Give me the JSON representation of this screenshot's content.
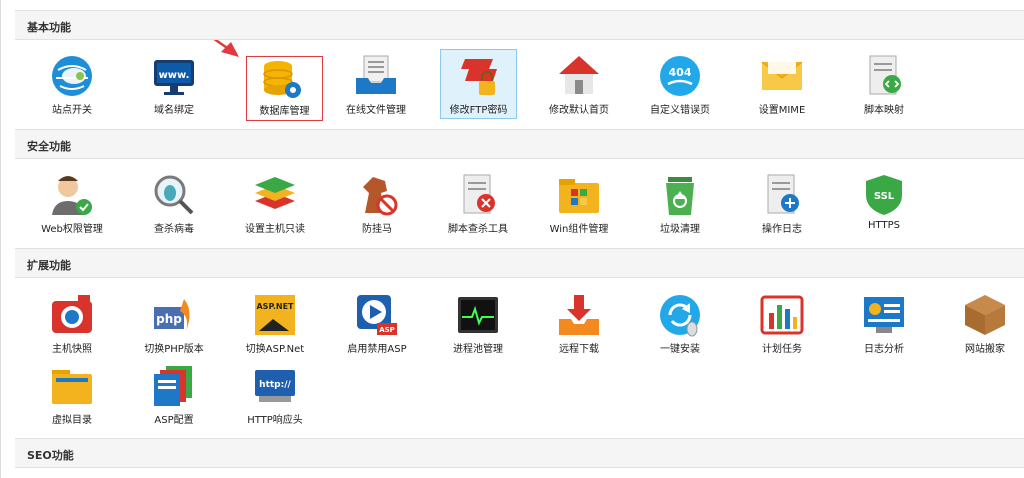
{
  "sections": {
    "basic": {
      "title": "基本功能",
      "items": [
        "站点开关",
        "域名绑定",
        "数据库管理",
        "在线文件管理",
        "修改FTP密码",
        "修改默认首页",
        "自定义错误页",
        "设置MIME",
        "脚本映射"
      ]
    },
    "security": {
      "title": "安全功能",
      "items": [
        "Web权限管理",
        "查杀病毒",
        "设置主机只读",
        "防挂马",
        "脚本查杀工具",
        "Win组件管理",
        "垃圾清理",
        "操作日志",
        "HTTPS"
      ]
    },
    "extension": {
      "title": "扩展功能",
      "items": [
        "主机快照",
        "切换PHP版本",
        "切换ASP.Net",
        "启用禁用ASP",
        "进程池管理",
        "远程下载",
        "一键安装",
        "计划任务",
        "日志分析",
        "网站搬家",
        "虚拟目录",
        "ASP配置",
        "HTTP响应头"
      ]
    },
    "seo": {
      "title": "SEO功能"
    }
  },
  "icon_text": {
    "www": "www.",
    "err404": "404",
    "ssl": "SSL",
    "aspnet": "ASP.NET",
    "asp": "ASP",
    "php": "php",
    "http": "http://"
  },
  "colors": {
    "highlight_bg": "#dff1fb",
    "annotation_red": "#e0393e",
    "header_bg": "#f5f5f5"
  }
}
